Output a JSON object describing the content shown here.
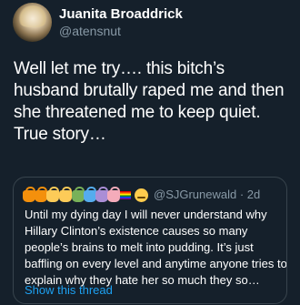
{
  "author": {
    "display_name": "Juanita Broaddrick",
    "handle": "@atensnut"
  },
  "tweet": {
    "text": "Well let me try…. this bitch’s husband brutally raped me and then she threatened me to keep quiet.  True story…"
  },
  "quoted_tweet": {
    "handle_time": "@SJGrunewald · 2d",
    "name_icons": [
      "bag-orange-icon",
      "bag-orange-icon",
      "bag-yellow-icon",
      "bag-green-icon",
      "bag-blue-icon",
      "bag-purple-icon",
      "bag-pink-icon",
      "rainbow-flag-icon",
      "smiley-icon"
    ],
    "text": "Until my dying day I will never understand why Hillary Clinton’s existence causes so many people’s brains to melt into pudding. It’s just baffling on every level and anytime anyone tries to explain why they hate her so much they so…",
    "show_thread_label": "Show this thread"
  },
  "colors": {
    "background": "#15202b",
    "secondary_text": "#8899a6",
    "link": "#1da1f2",
    "border": "#38444d"
  }
}
